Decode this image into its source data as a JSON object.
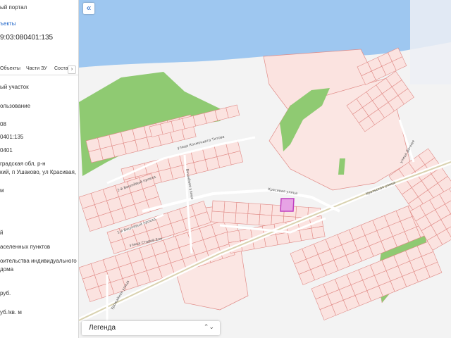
{
  "panel": {
    "portal_title": "ый портал",
    "objects_link": "ъекты",
    "cadastral_number": "9:03:080401:135",
    "tabs": [
      "Объекты",
      "Части ЗУ",
      "Соста"
    ],
    "tabs_arrow": "›",
    "fields": [
      "ый участок",
      "ользование",
      "08",
      "0401:135",
      "0401",
      "градская обл, р-н",
      "кий, п Ушаково, ул Красивая,",
      "",
      "м",
      "й",
      "аселенных пунктов",
      "оительства индивидуального",
      "дома",
      "руб.",
      "уб./кв. м"
    ]
  },
  "map": {
    "collapse_icon": "«",
    "legend_label": "Легенда",
    "legend_chevron": "⌃⌄",
    "streets": [
      "улица Космонавта Титова",
      "2-й Вишнёвый проезд",
      "1-й Вишнёвый проезд",
      "Вишнёвая улица",
      "Красивая улица",
      "Уральская улица",
      "Урожайная улица",
      "улица Старой Ели",
      "улица Дачная"
    ],
    "colors": {
      "water": "#9ec7f0",
      "parcel_fill": "#fbe3e0",
      "parcel_stroke": "#e08a86",
      "green": "#8fca72",
      "road": "#ffffff",
      "selected": "#c040c0"
    }
  }
}
